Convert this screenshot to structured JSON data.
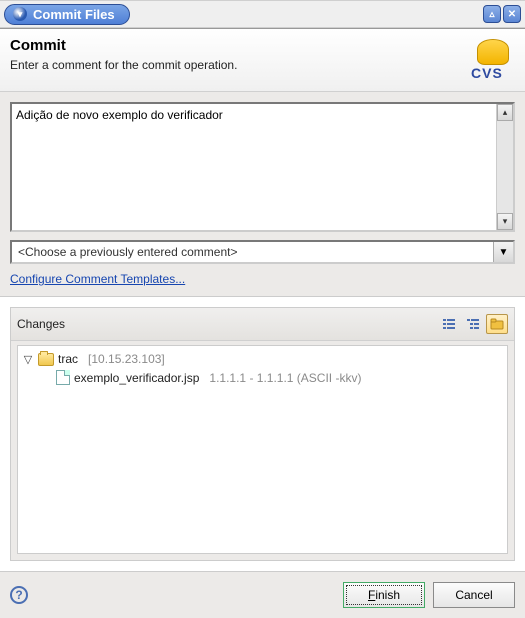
{
  "window": {
    "title": "Commit Files"
  },
  "header": {
    "title": "Commit",
    "subtitle": "Enter a comment for the commit operation.",
    "icon_label": "CVS"
  },
  "commit": {
    "comment_value": "Adição de novo exemplo do verificador",
    "prev_comment_placeholder": "<Choose a previously entered comment>",
    "configure_link": "Configure Comment Templates..."
  },
  "changes": {
    "title": "Changes",
    "tree": {
      "root": {
        "name": "trac",
        "location": "[10.15.23.103]"
      },
      "file": {
        "name": "exemplo_verificador.jsp",
        "rev": "1.1.1.1 - 1.1.1.1  (ASCII -kkv)"
      }
    }
  },
  "footer": {
    "finish": "Finish",
    "cancel": "Cancel"
  }
}
